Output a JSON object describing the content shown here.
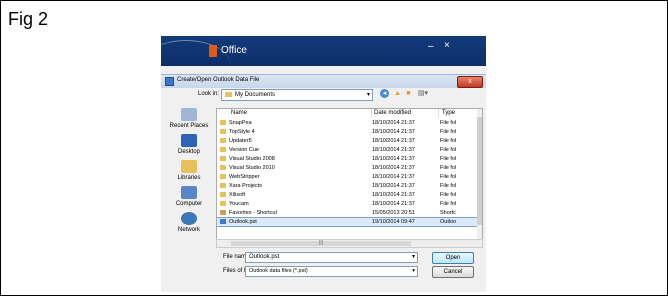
{
  "figure": {
    "label": "Fig 2"
  },
  "office_window": {
    "title": "Office",
    "minimize": "–",
    "close": "×"
  },
  "dialog": {
    "title": "Create/Open Outlook Data File",
    "close": "x",
    "look_in_label": "Look in:",
    "look_in_value": "My Documents",
    "places": [
      "Recent Places",
      "Desktop",
      "Libraries",
      "Computer",
      "Network"
    ],
    "columns": {
      "name": "Name",
      "date": "Date modified",
      "type": "Type"
    },
    "files": [
      {
        "name": "SnapPea",
        "date": "18/10/2014 21:37",
        "type": "File fol"
      },
      {
        "name": "TopStyle 4",
        "date": "18/10/2014 21:37",
        "type": "File fol"
      },
      {
        "name": "Updater5",
        "date": "18/10/2014 21:37",
        "type": "File fol"
      },
      {
        "name": "Version Cue",
        "date": "18/10/2014 21:37",
        "type": "File fol"
      },
      {
        "name": "Visual Studio 2008",
        "date": "18/10/2014 21:37",
        "type": "File fol"
      },
      {
        "name": "Visual Studio 2010",
        "date": "18/10/2014 21:37",
        "type": "File fol"
      },
      {
        "name": "WebStripper",
        "date": "18/10/2014 21:37",
        "type": "File fol"
      },
      {
        "name": "Xara Projects",
        "date": "18/10/2014 21:37",
        "type": "File fol"
      },
      {
        "name": "Xilisoft",
        "date": "18/10/2014 21:37",
        "type": "File fol"
      },
      {
        "name": "Youcam",
        "date": "18/10/2014 21:37",
        "type": "File fol"
      },
      {
        "name": "Favorites - Shortcut",
        "date": "15/05/2013 20:51",
        "type": "Shortc"
      },
      {
        "name": "Outlook.pst",
        "date": "19/10/2014 09:47",
        "type": "Outloo"
      }
    ],
    "file_name_label": "File name:",
    "file_name_value": "Outlook.pst",
    "file_type_label": "Files of type:",
    "file_type_value": "Outlook data files (*.pst)",
    "open_label": "Open",
    "cancel_label": "Cancel"
  }
}
